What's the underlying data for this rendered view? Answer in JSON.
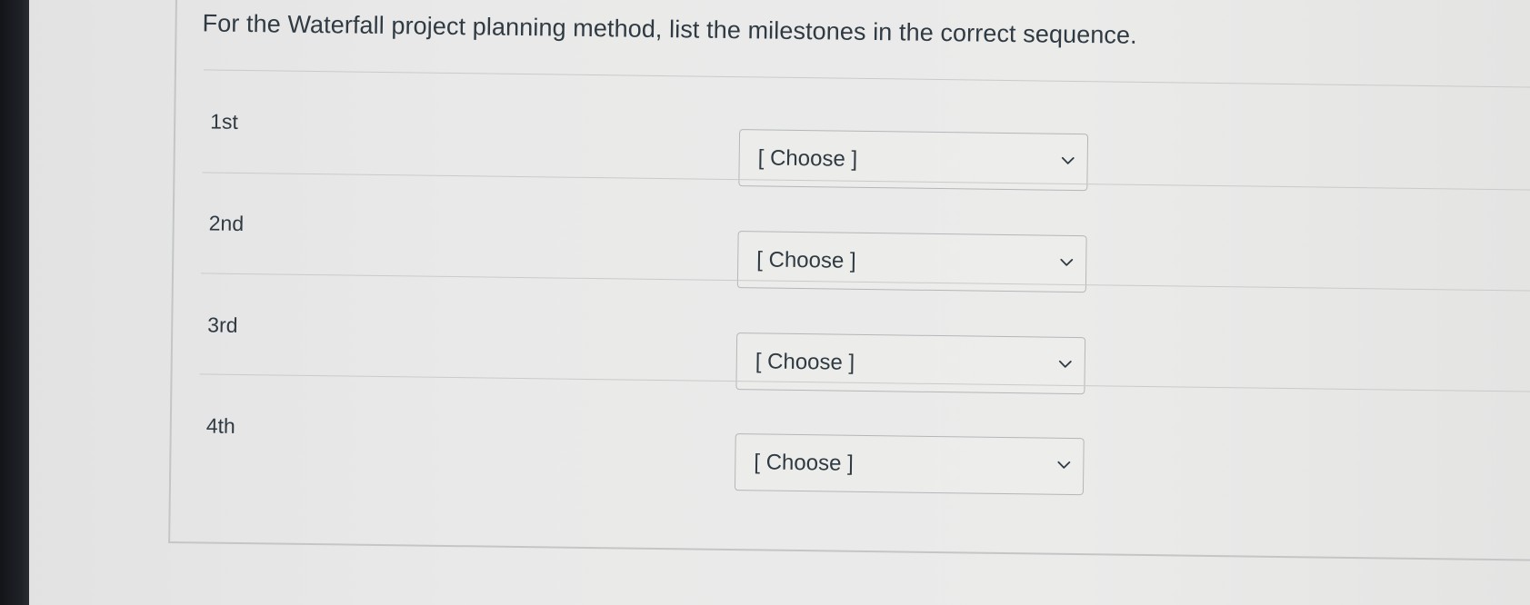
{
  "question": {
    "text": "For the Waterfall project planning method, list the milestones in the correct sequence."
  },
  "rows": [
    {
      "ordinal": "1st",
      "selected": "[ Choose ]"
    },
    {
      "ordinal": "2nd",
      "selected": "[ Choose ]"
    },
    {
      "ordinal": "3rd",
      "selected": "[ Choose ]"
    },
    {
      "ordinal": "4th",
      "selected": "[ Choose ]"
    }
  ],
  "icons": {
    "dropdown": "chevron-down-icon"
  }
}
